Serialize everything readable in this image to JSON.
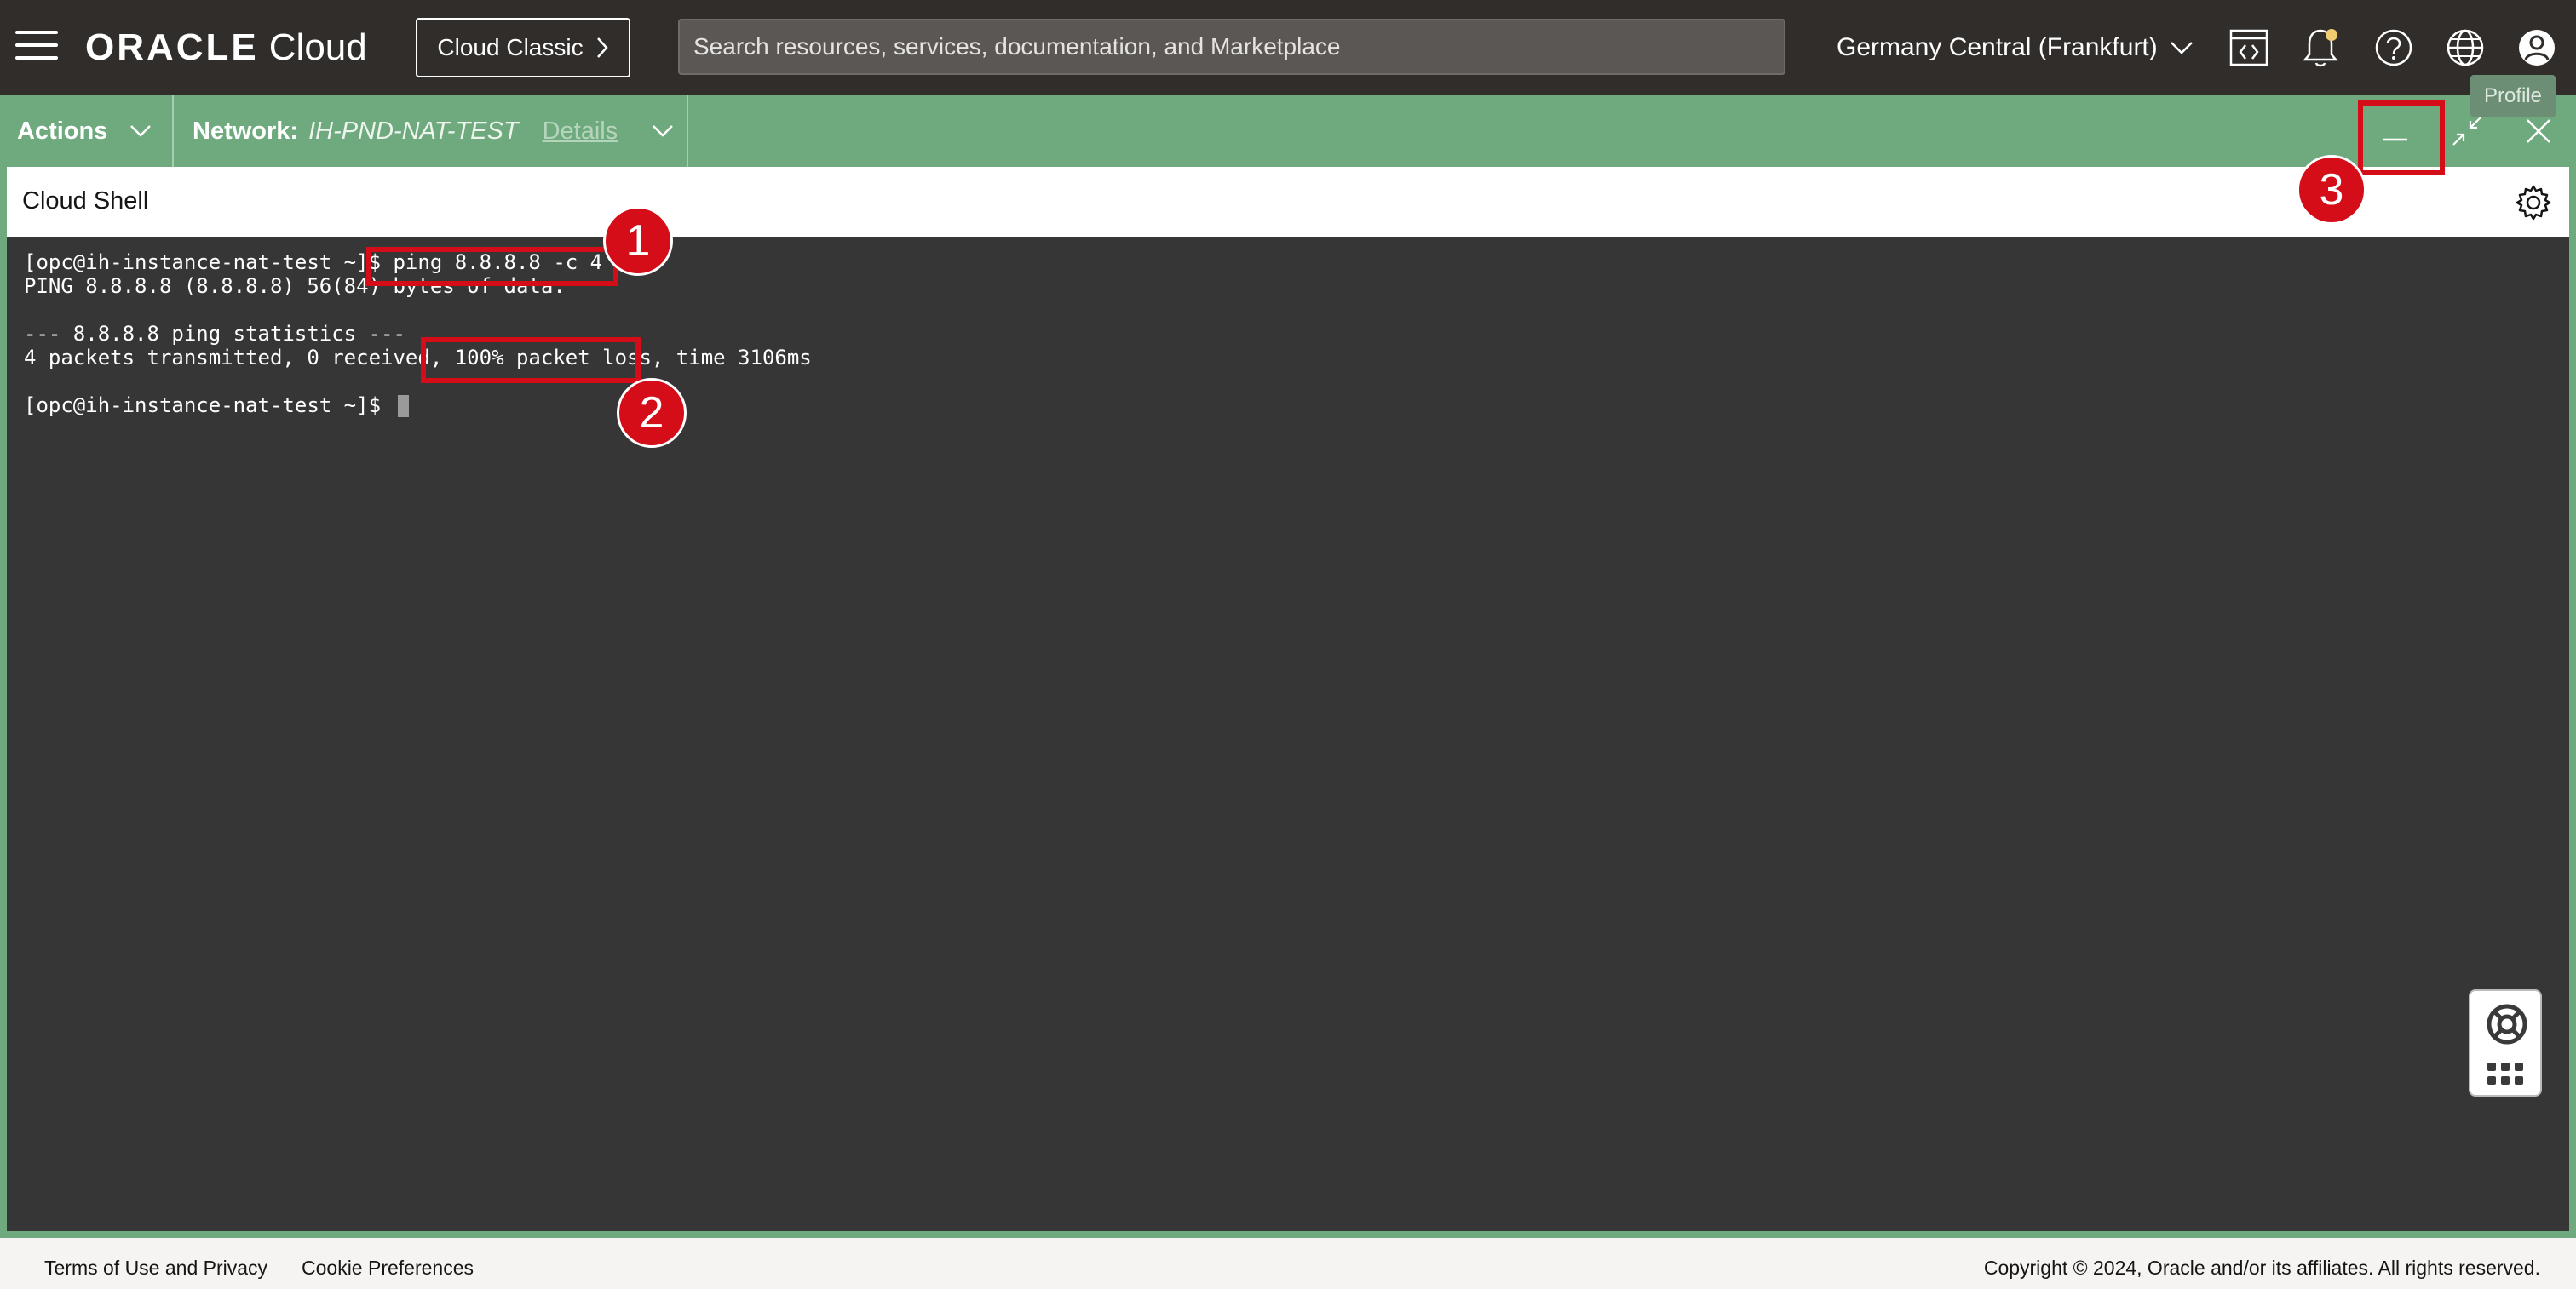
{
  "header": {
    "brand": "ORACLE",
    "brand_suffix": "Cloud",
    "classic_button": "Cloud Classic",
    "search_placeholder": "Search resources, services, documentation, and Marketplace",
    "region": "Germany Central (Frankfurt)",
    "tooltip": "Profile"
  },
  "actionbar": {
    "actions_label": "Actions",
    "network_label": "Network:",
    "network_value": "IH-PND-NAT-TEST",
    "details_link": "Details"
  },
  "shell": {
    "title": "Cloud Shell",
    "lines": [
      "[opc@ih-instance-nat-test ~]$ ping 8.8.8.8 -c 4",
      "PING 8.8.8.8 (8.8.8.8) 56(84) bytes of data.",
      "--- 8.8.8.8 ping statistics ---",
      "4 packets transmitted, 0 received, 100% packet loss, time 3106ms",
      "[opc@ih-instance-nat-test ~]$ "
    ]
  },
  "annotations": [
    "1",
    "2",
    "3"
  ],
  "footer": {
    "terms": "Terms of Use and Privacy",
    "cookies": "Cookie Preferences",
    "copyright": "Copyright © 2024, Oracle and/or its affiliates. All rights reserved."
  },
  "colors": {
    "header_bg": "#312d2a",
    "accent_green": "#6faa7e",
    "terminal_bg": "#363636",
    "highlight_red": "#d40d18"
  }
}
